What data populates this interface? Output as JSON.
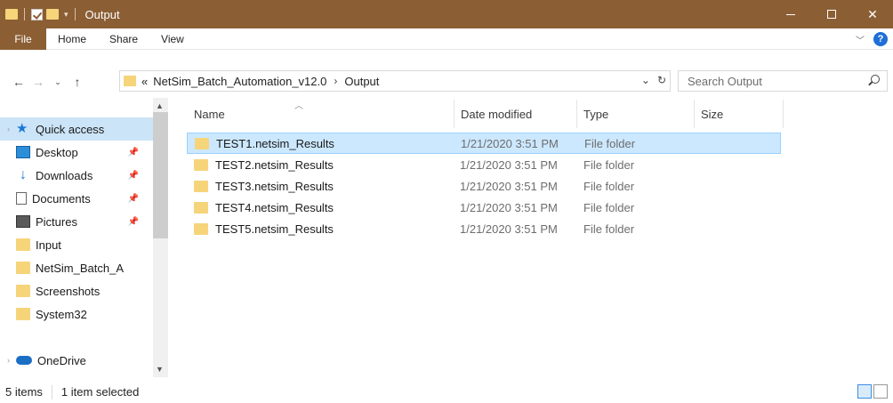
{
  "window": {
    "title": "Output",
    "controls": {
      "minimize": "—",
      "maximize": "☐",
      "close": "✕"
    }
  },
  "ribbon": {
    "tabs": [
      "File",
      "Home",
      "Share",
      "View"
    ]
  },
  "address": {
    "overflow": "«",
    "path": [
      "NetSim_Batch_Automation_v12.0",
      "Output"
    ],
    "search_placeholder": "Search Output"
  },
  "nav": {
    "items": [
      {
        "label": "Quick access",
        "icon": "star-icon",
        "selected": true
      },
      {
        "label": "Desktop",
        "icon": "desktop-icon",
        "pinned": true
      },
      {
        "label": "Downloads",
        "icon": "downloads-icon",
        "pinned": true
      },
      {
        "label": "Documents",
        "icon": "documents-icon",
        "pinned": true
      },
      {
        "label": "Pictures",
        "icon": "pictures-icon",
        "pinned": true
      },
      {
        "label": "Input",
        "icon": "folder-icon"
      },
      {
        "label": "NetSim_Batch_A",
        "icon": "folder-icon"
      },
      {
        "label": "Screenshots",
        "icon": "folder-icon"
      },
      {
        "label": "System32",
        "icon": "folder-icon"
      },
      {
        "label": "OneDrive",
        "icon": "cloud-icon"
      }
    ]
  },
  "columns": [
    "Name",
    "Date modified",
    "Type",
    "Size"
  ],
  "files": [
    {
      "name": "TEST1.netsim_Results",
      "date": "1/21/2020 3:51 PM",
      "type": "File folder",
      "selected": true
    },
    {
      "name": "TEST2.netsim_Results",
      "date": "1/21/2020 3:51 PM",
      "type": "File folder"
    },
    {
      "name": "TEST3.netsim_Results",
      "date": "1/21/2020 3:51 PM",
      "type": "File folder"
    },
    {
      "name": "TEST4.netsim_Results",
      "date": "1/21/2020 3:51 PM",
      "type": "File folder"
    },
    {
      "name": "TEST5.netsim_Results",
      "date": "1/21/2020 3:51 PM",
      "type": "File folder"
    }
  ],
  "status": {
    "count": "5 items",
    "selection": "1 item selected"
  },
  "colors": {
    "accent": "#8b5e34",
    "selection": "#cce8ff",
    "folder": "#f6d47a"
  }
}
